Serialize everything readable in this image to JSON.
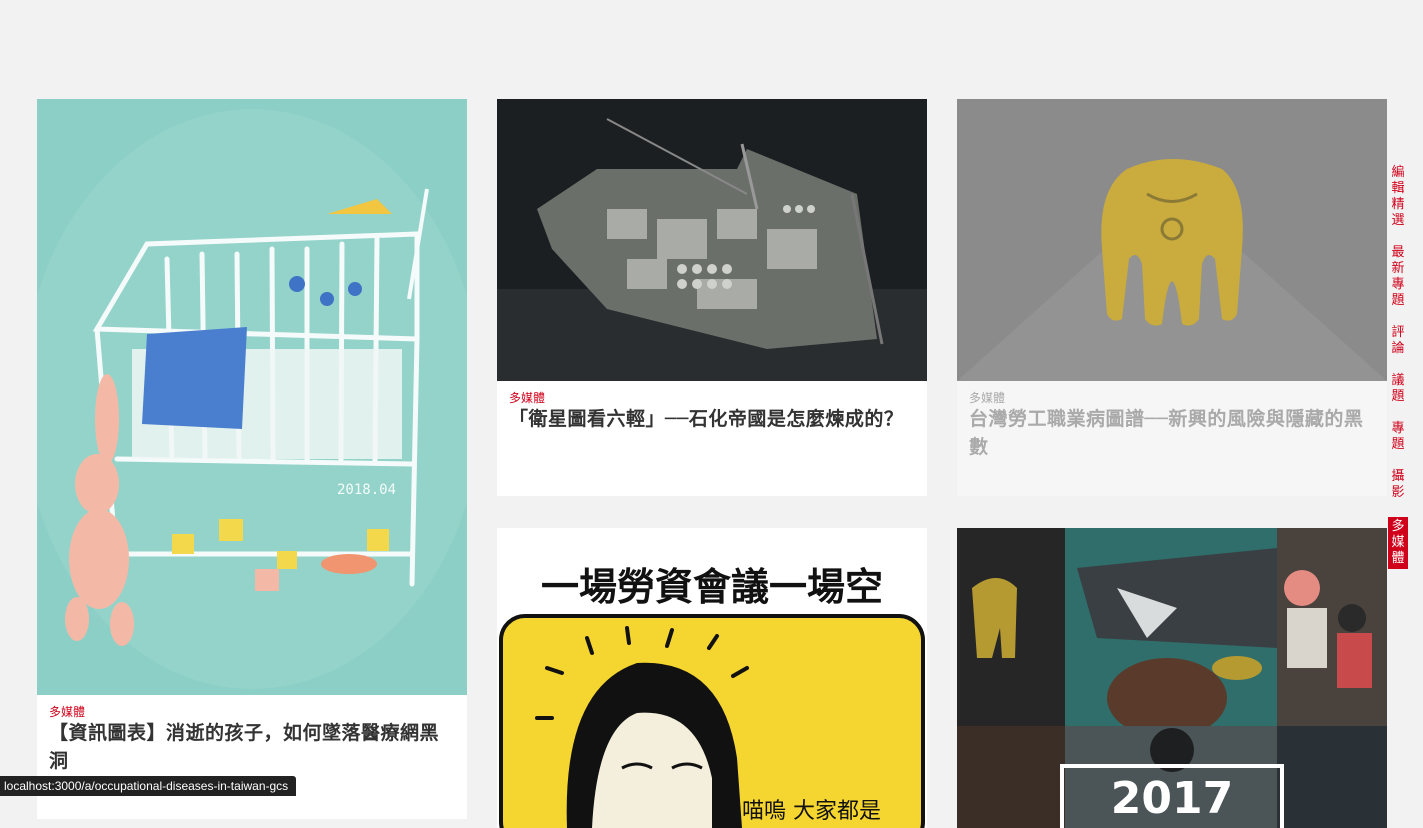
{
  "cards": [
    {
      "category": "多媒體",
      "title": "【資訊圖表】消逝的孩子，如何墜落醫療網黑洞",
      "image": "illustrated-crib-with-bunny"
    },
    {
      "category": "多媒體",
      "title": "「衛星圖看六輕」──石化帝國是怎麼煉成的？",
      "image": "satellite-industrial-island"
    },
    {
      "category": "多媒體",
      "title": "台灣勞工職業病圖譜──新興的風險與隱藏的黑數",
      "image": "yellow-elephant-icon"
    },
    {
      "category": "",
      "title": "",
      "image": "labor-meeting-illustration",
      "image_text": "一場勞資會議一場空",
      "image_subtext": "喵嗚 大家都是"
    },
    {
      "category": "",
      "title": "",
      "image": "photo-collage-2017",
      "image_text": "2017"
    }
  ],
  "sidenav": [
    {
      "label": "編輯精選",
      "active": false
    },
    {
      "label": "最新專題",
      "active": false
    },
    {
      "label": "評論",
      "active": false
    },
    {
      "label": "議題",
      "active": false
    },
    {
      "label": "專題",
      "active": false
    },
    {
      "label": "攝影",
      "active": false
    },
    {
      "label": "多媒體",
      "active": true
    }
  ],
  "status_url": "localhost:3000/a/occupational-diseases-in-taiwan-gcs",
  "colors": {
    "accent": "#d0021b",
    "background": "#f2f2f2"
  }
}
